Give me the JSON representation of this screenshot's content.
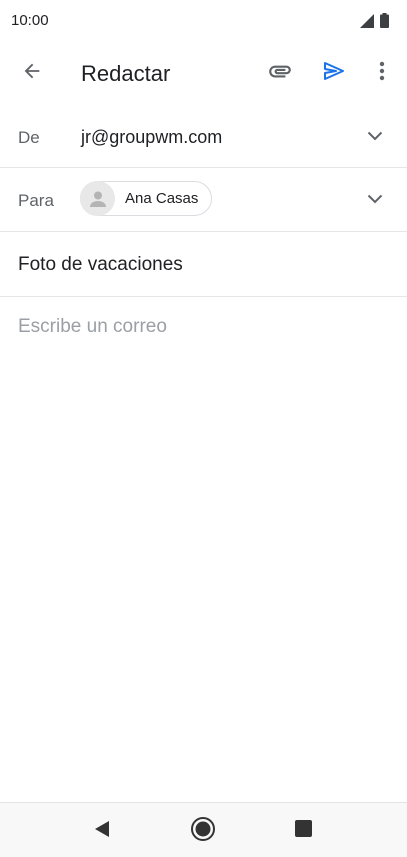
{
  "status": {
    "time": "10:00"
  },
  "toolbar": {
    "title": "Redactar",
    "back_icon": "arrow-back-icon",
    "attach_icon": "paperclip-icon",
    "send_icon": "send-icon",
    "more_icon": "more-vert-icon",
    "accent_color": "#1a73e8"
  },
  "compose": {
    "from_label": "De",
    "from_value": "jr@groupwm.com",
    "to_label": "Para",
    "to_recipient": "Ana Casas",
    "subject": "Foto de vacaciones",
    "body_placeholder": "Escribe un correo"
  },
  "navigation": {
    "back_icon": "nav-back-icon",
    "home_icon": "nav-home-icon",
    "recents_icon": "nav-recents-icon"
  }
}
